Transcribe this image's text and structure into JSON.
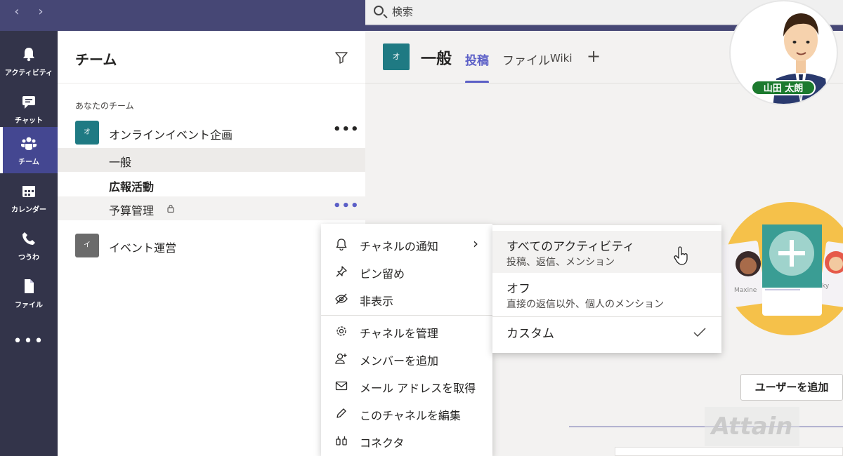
{
  "search": {
    "placeholder": "検索"
  },
  "rail": {
    "items": [
      {
        "label": "アクティビティ"
      },
      {
        "label": "チャット"
      },
      {
        "label": "チーム"
      },
      {
        "label": "カレンダー"
      },
      {
        "label": "つうわ"
      },
      {
        "label": "ファイル"
      }
    ],
    "more": "•••"
  },
  "panel": {
    "title": "チーム",
    "section": "あなたのチーム",
    "teams": [
      {
        "avatar": "オ",
        "name": "オンラインイベント企画",
        "color": "#1f7a83"
      },
      {
        "avatar": "イ",
        "name": "イベント運営",
        "color": "#6b6b6b"
      }
    ],
    "channels": [
      {
        "name": "一般"
      },
      {
        "name": "広報活動"
      },
      {
        "name": "予算管理"
      }
    ],
    "more": "•••"
  },
  "channel_header": {
    "avatar": "オ",
    "title": "一般",
    "tabs": [
      "投稿",
      "ファイル",
      "Wiki"
    ],
    "add_tab": "+"
  },
  "context_menu": {
    "items": [
      {
        "label": "チャネルの通知"
      },
      {
        "label": "ピン留め"
      },
      {
        "label": "非表示"
      },
      {
        "label": "チャネルを管理"
      },
      {
        "label": "メンバーを追加"
      },
      {
        "label": "メール アドレスを取得"
      },
      {
        "label": "このチャネルを編集"
      },
      {
        "label": "コネクタ"
      }
    ]
  },
  "notification_submenu": {
    "options": [
      {
        "title": "すべてのアクティビティ",
        "subtitle": "投稿、返信、メンション"
      },
      {
        "title": "オフ",
        "subtitle": "直接の返信以外、個人のメンション"
      },
      {
        "title": "カスタム",
        "subtitle": ""
      }
    ]
  },
  "illustration": {
    "card_name_1": "Maxine",
    "card_name_2": "ky"
  },
  "add_user_button": "ユーザーを追加",
  "watermark": "Attain",
  "presenter": {
    "name": "山田 太朗"
  },
  "colors": {
    "rail": "#33344a",
    "topbar": "#464775",
    "accent": "#5b5fc7",
    "teal": "#1f7a83"
  }
}
